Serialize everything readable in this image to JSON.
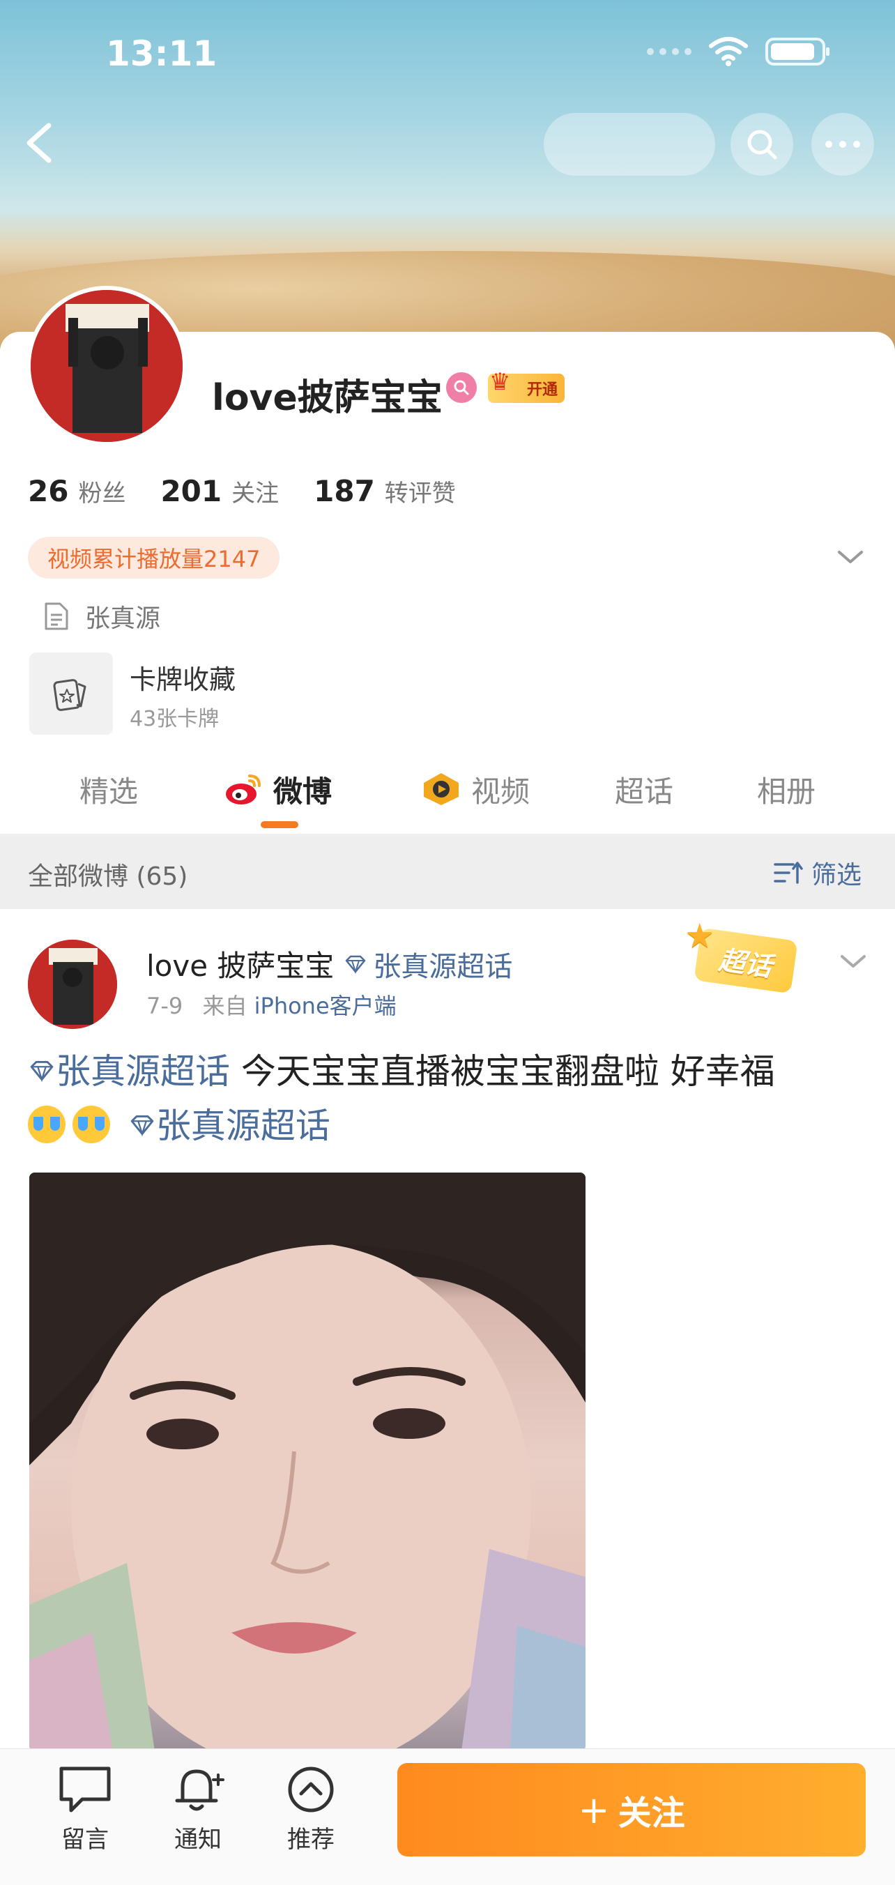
{
  "status_bar": {
    "time": "13:11"
  },
  "profile": {
    "username": "love披萨宝宝",
    "vip_label": "开通",
    "stats": [
      {
        "num": "26",
        "label": "粉丝"
      },
      {
        "num": "201",
        "label": "关注"
      },
      {
        "num": "187",
        "label": "转评赞"
      }
    ],
    "play_count_tag": "视频累计播放量2147",
    "description": "张真源",
    "card_collection": {
      "title": "卡牌收藏",
      "sub": "43张卡牌"
    }
  },
  "tabs": [
    {
      "label": "精选",
      "active": false
    },
    {
      "label": "微博",
      "active": true
    },
    {
      "label": "视频",
      "active": false
    },
    {
      "label": "超话",
      "active": false
    },
    {
      "label": "相册",
      "active": false
    }
  ],
  "feed": {
    "header_label": "全部微博 (65)",
    "filter_label": "筛选"
  },
  "post": {
    "author": "love 披萨宝宝",
    "topic_chip": "张真源超话",
    "date": "7-9",
    "source_prefix": "来自",
    "source": "iPhone客户端",
    "super_badge": "超话",
    "text_topic_1": "张真源超话",
    "text_body": " 今天宝宝直播被宝宝翻盘啦 好幸福",
    "text_topic_2": "张真源超话"
  },
  "bottom_bar": {
    "items": [
      {
        "label": "留言",
        "icon": "message-icon"
      },
      {
        "label": "通知",
        "icon": "bell-icon"
      },
      {
        "label": "推荐",
        "icon": "recommend-icon"
      }
    ],
    "follow_label": "关注"
  },
  "colors": {
    "accent_orange": "#f57b22",
    "link_blue": "#4b6d9c",
    "tag_bg": "#fde9de"
  }
}
